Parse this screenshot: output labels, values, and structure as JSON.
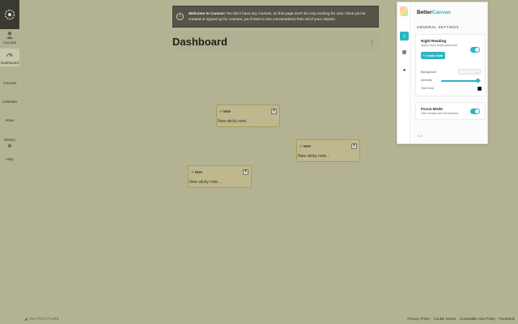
{
  "nav": {
    "items": [
      {
        "label": "Account",
        "icon": "user-avatar-icon"
      },
      {
        "label": "Dashboard",
        "icon": "dashboard-icon"
      },
      {
        "label": "Courses",
        "icon": "courses-icon"
      },
      {
        "label": "Calendar",
        "icon": "calendar-icon"
      },
      {
        "label": "Inbox",
        "icon": "inbox-icon"
      },
      {
        "label": "History",
        "icon": "history-icon"
      },
      {
        "label": "Help",
        "icon": "help-icon"
      }
    ],
    "active": "Dashboard",
    "brand": "INSTRUCTURE"
  },
  "banner": {
    "title": "Welcome to Canvas!",
    "text": "You don't have any courses, so this page won't be very exciting for now. Once you've created or signed up for courses, you'll start to see conversations from all of your classes."
  },
  "dashboard": {
    "title": "Dashboard"
  },
  "notes": [
    {
      "header": "Note",
      "body": "New sticky note..."
    },
    {
      "header": "Note",
      "body": "New sticky note..."
    },
    {
      "header": "Note",
      "body": "New sticky note..."
    }
  ],
  "footer": {
    "links": [
      "Privacy Policy",
      "Cookie Notice",
      "Acceptable Use Policy",
      "Facebook"
    ]
  },
  "panel": {
    "title_part1": "Better",
    "title_part2": "Canvas",
    "section": "GENERAL SETTINGS",
    "night_reading": {
      "title": "Night Reading",
      "subtitle": "Apply warm sepia darkmode",
      "enabled": true,
      "button": "+ Create Note",
      "background_label": "Background",
      "intensity_label": "Intensity",
      "intensity_value": 0.9,
      "text_color_label": "Text Color",
      "text_color": "#000000"
    },
    "focus_mode": {
      "title": "Focus Mode",
      "subtitle": "Hide badges and distractions",
      "enabled": true
    },
    "version": "v1.0",
    "accent": "#2bb5c4"
  }
}
